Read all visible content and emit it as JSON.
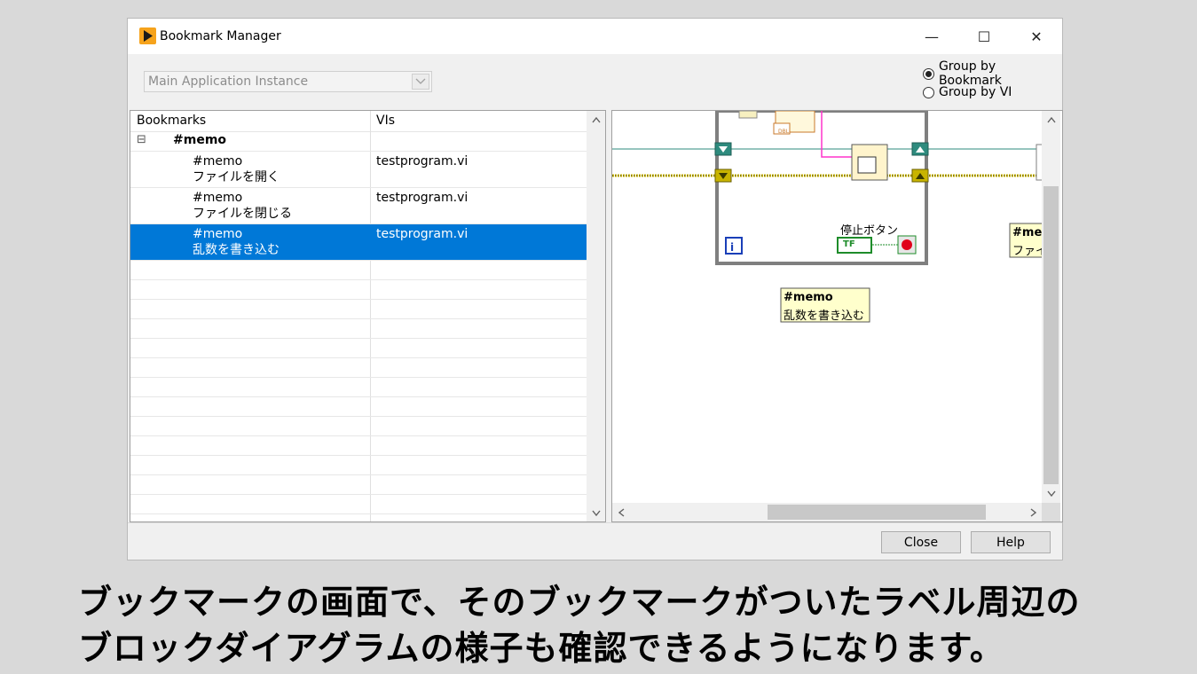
{
  "window": {
    "title": "Bookmark Manager",
    "minimize": "—",
    "maximize": "☐",
    "close": "✕"
  },
  "instance": {
    "value": "Main Application Instance"
  },
  "grouping": {
    "by_bookmark": "Group by Bookmark",
    "by_vi": "Group by VI",
    "selected": "by_bookmark"
  },
  "list": {
    "headers": {
      "bookmarks": "Bookmarks",
      "vis": "VIs"
    },
    "group": {
      "expander": "⊟",
      "name": "#memo"
    },
    "items": [
      {
        "line1": "#memo",
        "line2": "ファイルを開く",
        "vi": "testprogram.vi"
      },
      {
        "line1": "#memo",
        "line2": "ファイルを閉じる",
        "vi": "testprogram.vi"
      },
      {
        "line1": "#memo",
        "line2": "乱数を書き込む",
        "vi": "testprogram.vi"
      }
    ]
  },
  "diagram": {
    "stop_label": "停止ボタン",
    "tf_label": "TF",
    "iter_label": "i",
    "dbl_label": "DBL",
    "comment_line1": "#memo",
    "comment_line2": "乱数を書き込む",
    "edge_comment_line1": "#me",
    "edge_comment_line2": "ファイ"
  },
  "buttons": {
    "close": "Close",
    "help": "Help"
  },
  "caption": {
    "line1": "ブックマークの画面で、そのブックマークがついたラベル周辺の",
    "line2": "ブロックダイアグラムの様子も確認できるようになります。"
  }
}
